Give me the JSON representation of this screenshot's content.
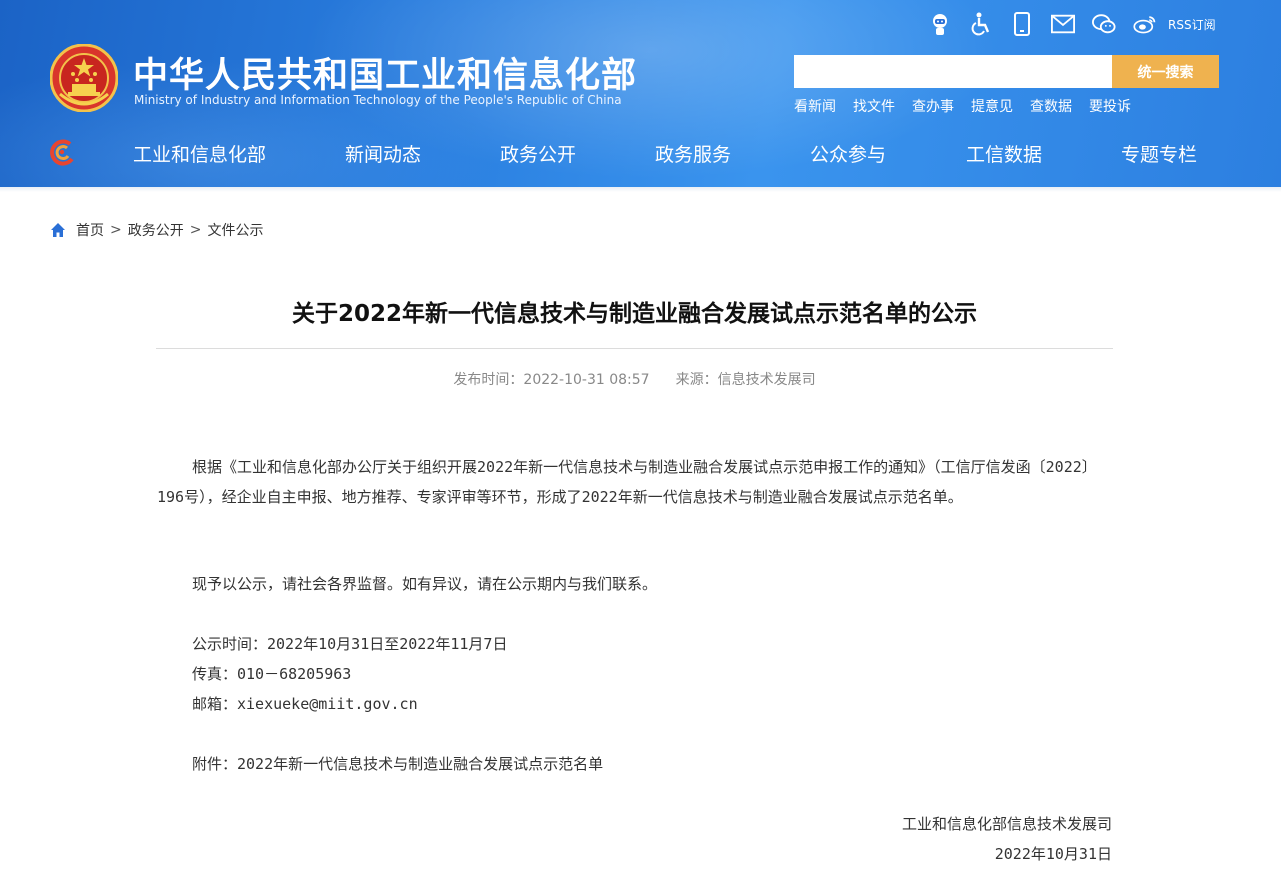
{
  "header": {
    "site_title": "中华人民共和国工业和信息化部",
    "site_subtitle": "Ministry of Industry and Information Technology of the People's Republic of China",
    "icons": [
      "robot-assistant-icon",
      "accessibility-icon",
      "mobile-icon",
      "mail-icon",
      "wechat-icon",
      "weibo-icon"
    ],
    "rss_label": "RSS订阅",
    "search": {
      "placeholder": "",
      "button_label": "统一搜索"
    },
    "quick_links": [
      "看新闻",
      "找文件",
      "查办事",
      "提意见",
      "查数据",
      "要投诉"
    ],
    "nav": [
      "工业和信息化部",
      "新闻动态",
      "政务公开",
      "政务服务",
      "公众参与",
      "工信数据",
      "专题专栏"
    ],
    "colors": {
      "header_blue": "#2a7fe0",
      "search_button": "#efb24f"
    }
  },
  "breadcrumb": {
    "items": [
      "首页",
      "政务公开",
      "文件公示"
    ],
    "separator": ">"
  },
  "article": {
    "title": "关于2022年新一代信息技术与制造业融合发展试点示范名单的公示",
    "publish_label": "发布时间：",
    "publish_time": "2022-10-31 08:57",
    "source_label": "来源：",
    "source": "信息技术发展司",
    "paragraph1": "根据《工业和信息化部办公厅关于组织开展2022年新一代信息技术与制造业融合发展试点示范申报工作的通知》（工信厅信发函〔2022〕196号），经企业自主申报、地方推荐、专家评审等环节，形成了2022年新一代信息技术与制造业融合发展试点示范名单。",
    "paragraph2": "现予以公示，请社会各界监督。如有异议，请在公示期内与我们联系。",
    "notice_period": "公示时间：2022年10月31日至2022年11月7日",
    "fax": "传真：010－68205963",
    "email": "邮箱：xiexueke@miit.gov.cn",
    "attachment": "附件：2022年新一代信息技术与制造业融合发展试点示范名单",
    "signature_org": "工业和信息化部信息技术发展司",
    "signature_date": "2022年10月31日"
  }
}
